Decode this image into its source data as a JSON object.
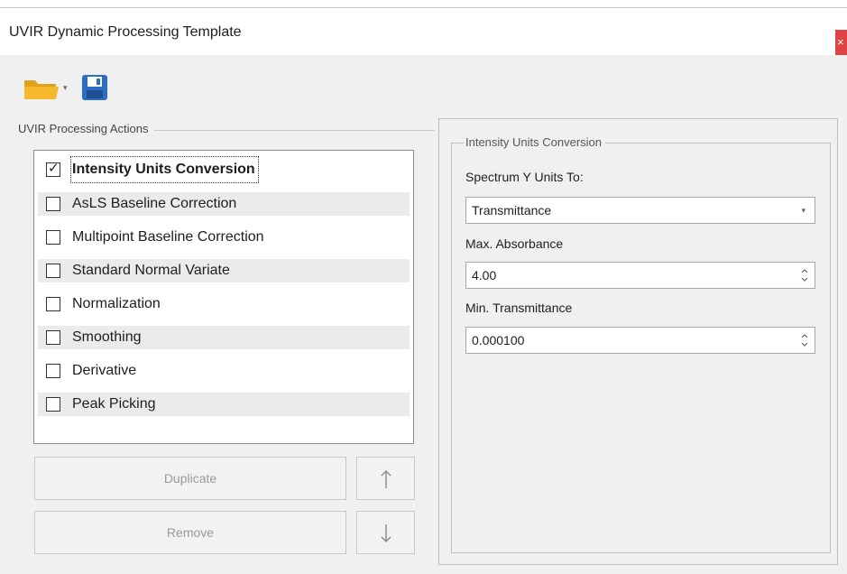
{
  "window": {
    "title": "UVIR Dynamic Processing Template",
    "close_glyph": "×"
  },
  "toolbar": {
    "open_icon": "folder-icon",
    "save_icon": "save-icon",
    "caret_glyph": "▾"
  },
  "actions_group": {
    "label": "UVIR Processing Actions",
    "items": [
      {
        "label": "Intensity Units Conversion",
        "checked": true,
        "selected": true
      },
      {
        "label": "AsLS Baseline Correction",
        "checked": false
      },
      {
        "label": "Multipoint Baseline Correction",
        "checked": false
      },
      {
        "label": "Standard Normal Variate",
        "checked": false
      },
      {
        "label": "Normalization",
        "checked": false
      },
      {
        "label": "Smoothing",
        "checked": false
      },
      {
        "label": "Derivative",
        "checked": false
      },
      {
        "label": "Peak Picking",
        "checked": false
      }
    ],
    "duplicate_label": "Duplicate",
    "remove_label": "Remove",
    "move_up_icon": "arrow-up-icon",
    "move_down_icon": "arrow-down-icon"
  },
  "settings": {
    "group_label": "Intensity Units Conversion",
    "y_units_label": "Spectrum Y Units To:",
    "y_units_value": "Transmittance",
    "max_abs_label": "Max. Absorbance",
    "max_abs_value": "4.00",
    "min_trans_label": "Min. Transmittance",
    "min_trans_value": "0.000100"
  },
  "colors": {
    "close_button": "#e04343",
    "window_bg": "#f0f0f0",
    "alt_row": "#ebebeb"
  }
}
